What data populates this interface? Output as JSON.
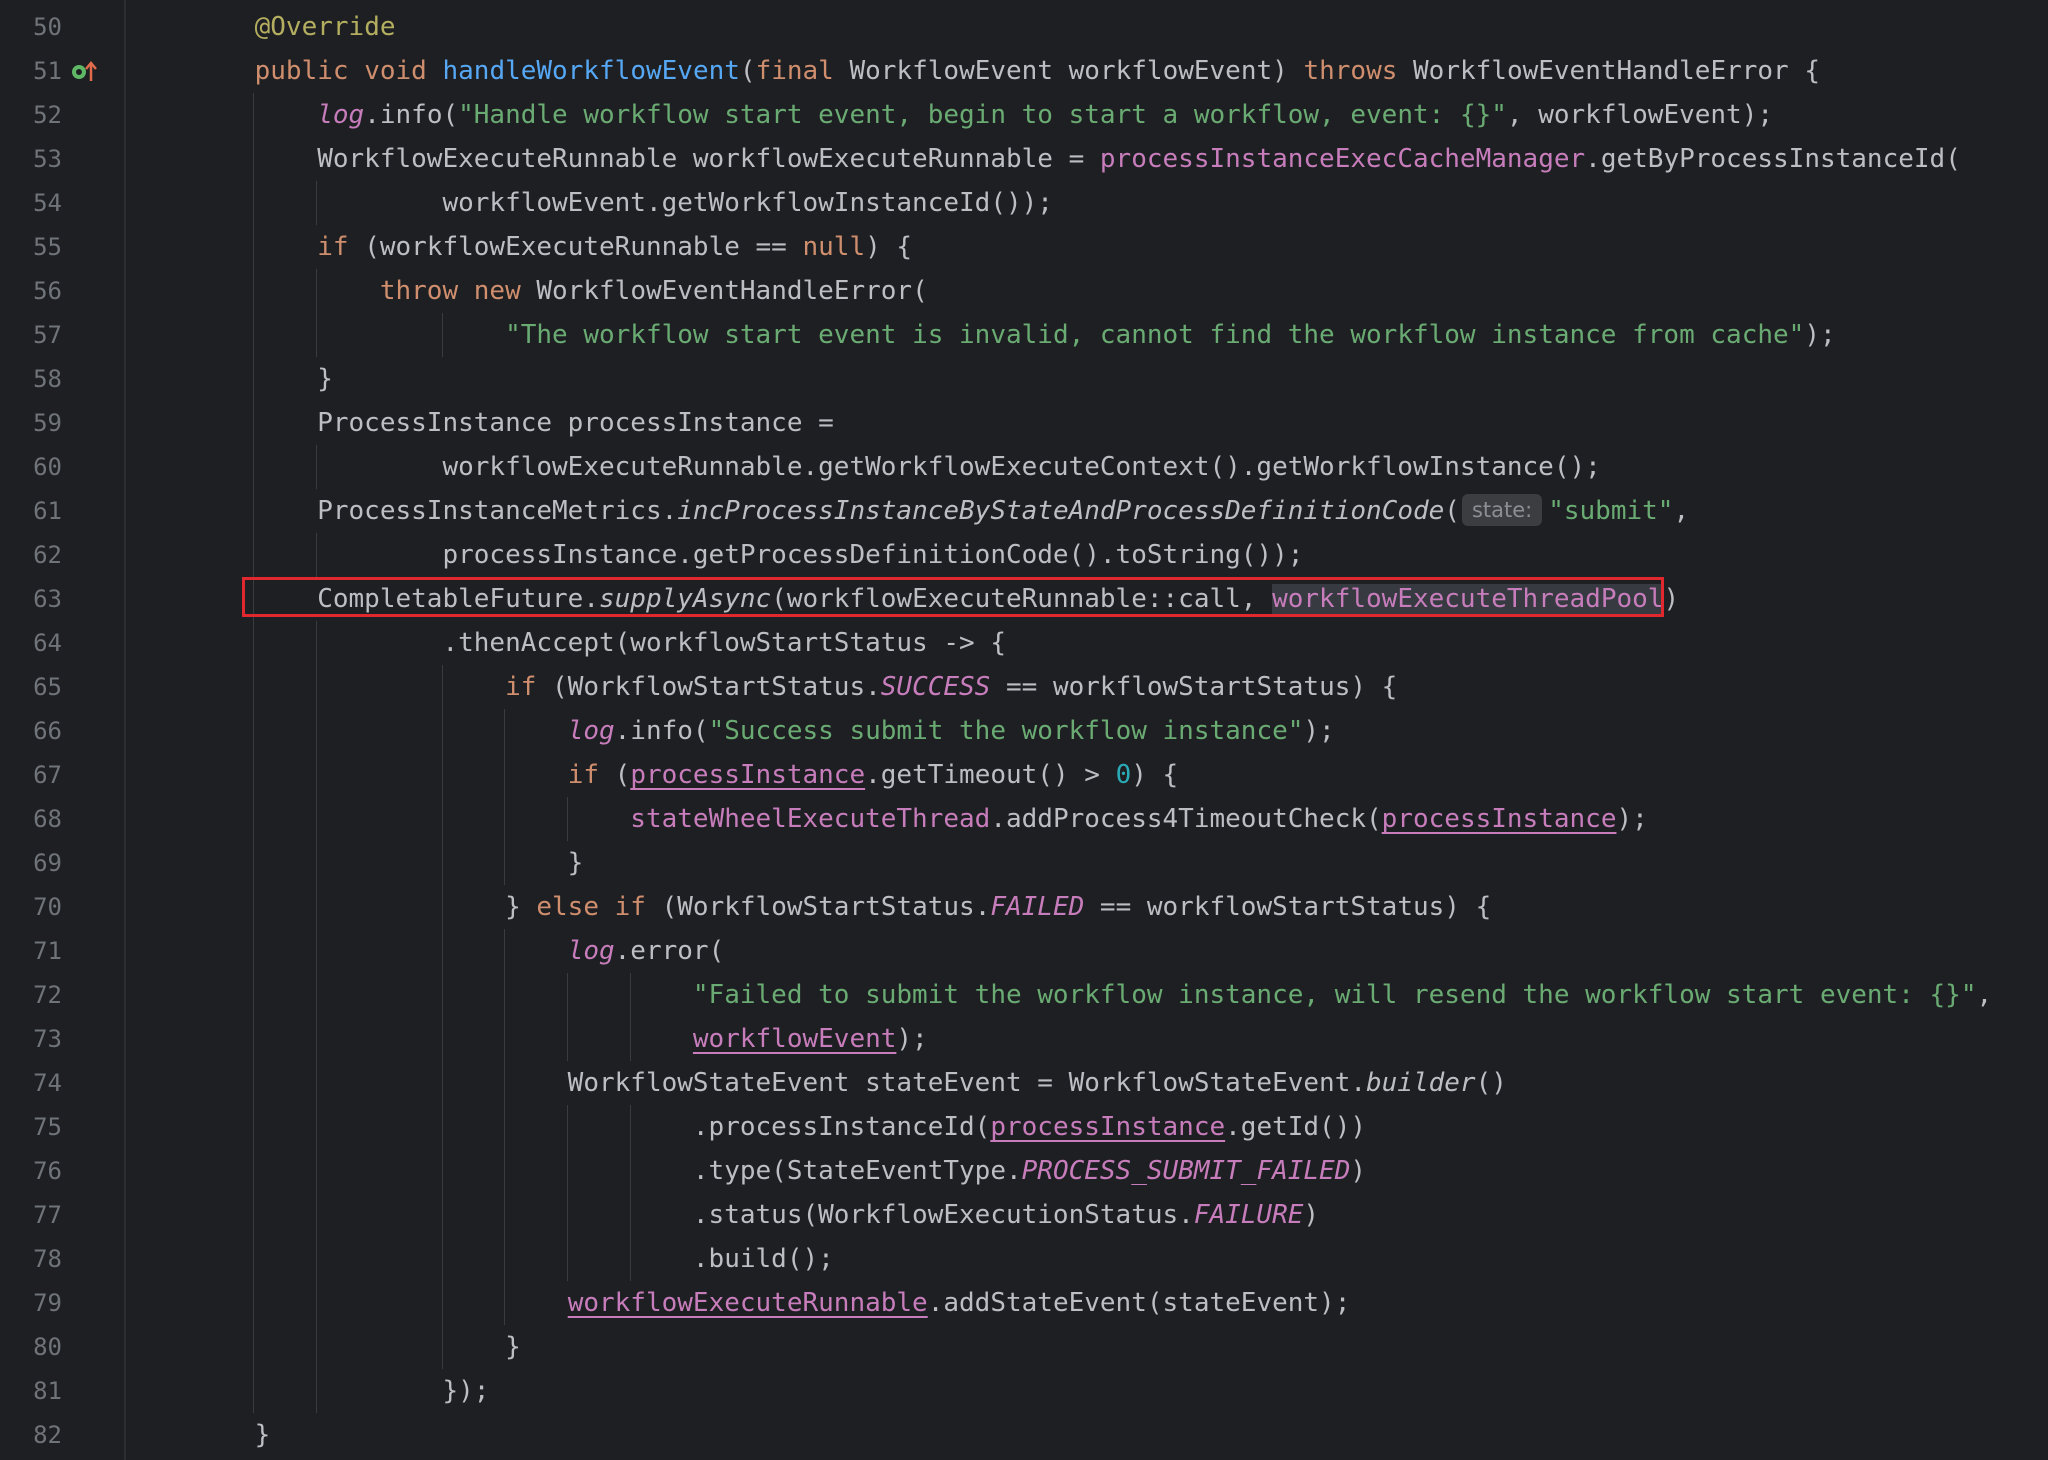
{
  "editor": {
    "line_numbers": [
      "50",
      "51",
      "52",
      "53",
      "54",
      "55",
      "56",
      "57",
      "58",
      "59",
      "60",
      "61",
      "62",
      "63",
      "64",
      "65",
      "66",
      "67",
      "68",
      "69",
      "70",
      "71",
      "72",
      "73",
      "74",
      "75",
      "76",
      "77",
      "78",
      "79",
      "80",
      "81",
      "82"
    ],
    "gutter_icon": "override-implementation-icon",
    "colors": {
      "background": "#1e1f22",
      "keyword": "#cf8e6d",
      "string": "#6aab73",
      "function": "#56a8f5",
      "field": "#c77dbb",
      "annotation": "#b3ae60",
      "number": "#2aacb8",
      "highlight_border": "#e0282e"
    },
    "lines": [
      [
        {
          "t": "    "
        },
        {
          "t": "@Override",
          "c": "ann"
        }
      ],
      [
        {
          "t": "    "
        },
        {
          "t": "public",
          "c": "kw"
        },
        {
          "t": " "
        },
        {
          "t": "void",
          "c": "kw"
        },
        {
          "t": " "
        },
        {
          "t": "handleWorkflowEvent",
          "c": "fn"
        },
        {
          "t": "("
        },
        {
          "t": "final",
          "c": "kw"
        },
        {
          "t": " WorkflowEvent workflowEvent) "
        },
        {
          "t": "throws",
          "c": "kw"
        },
        {
          "t": " WorkflowEventHandleError {"
        }
      ],
      [
        {
          "t": "        "
        },
        {
          "t": "log",
          "c": "static"
        },
        {
          "t": ".info("
        },
        {
          "t": "\"Handle workflow start event, begin to start a workflow, event: {}\"",
          "c": "str"
        },
        {
          "t": ", workflowEvent);"
        }
      ],
      [
        {
          "t": "        WorkflowExecuteRunnable workflowExecuteRunnable = "
        },
        {
          "t": "processInstanceExecCacheManager",
          "c": "field"
        },
        {
          "t": ".getByProcessInstanceId("
        }
      ],
      [
        {
          "t": "                workflowEvent.getWorkflowInstanceId());"
        }
      ],
      [
        {
          "t": "        "
        },
        {
          "t": "if",
          "c": "kw"
        },
        {
          "t": " (workflowExecuteRunnable == "
        },
        {
          "t": "null",
          "c": "kw"
        },
        {
          "t": ") {"
        }
      ],
      [
        {
          "t": "            "
        },
        {
          "t": "throw",
          "c": "kw"
        },
        {
          "t": " "
        },
        {
          "t": "new",
          "c": "kw"
        },
        {
          "t": " WorkflowEventHandleError("
        }
      ],
      [
        {
          "t": "                    "
        },
        {
          "t": "\"The workflow start event is invalid, cannot find the workflow instance from cache\"",
          "c": "str"
        },
        {
          "t": ");"
        }
      ],
      [
        {
          "t": "        }"
        }
      ],
      [
        {
          "t": "        ProcessInstance processInstance ="
        }
      ],
      [
        {
          "t": "                workflowExecuteRunnable.getWorkflowExecuteContext().getWorkflowInstance();"
        }
      ],
      [
        {
          "t": "        ProcessInstanceMetrics."
        },
        {
          "t": "incProcessInstanceByStateAndProcessDefinitionCode",
          "c": "italic"
        },
        {
          "t": "("
        },
        {
          "t": "state:",
          "c": "hint"
        },
        {
          "t": "\"submit\"",
          "c": "str"
        },
        {
          "t": ","
        }
      ],
      [
        {
          "t": "                processInstance.getProcessDefinitionCode().toString());"
        }
      ],
      [
        {
          "t": "        CompletableFuture."
        },
        {
          "t": "supplyAsync",
          "c": "italic"
        },
        {
          "t": "(workflowExecuteRunnable::call, "
        },
        {
          "t": "workflowExecuteThreadPool",
          "c": "hl"
        },
        {
          "t": ")"
        }
      ],
      [
        {
          "t": "                .thenAccept(workflowStartStatus -> {"
        }
      ],
      [
        {
          "t": "                    "
        },
        {
          "t": "if",
          "c": "kw"
        },
        {
          "t": " (WorkflowStartStatus."
        },
        {
          "t": "SUCCESS",
          "c": "static"
        },
        {
          "t": " == workflowStartStatus) {"
        }
      ],
      [
        {
          "t": "                        "
        },
        {
          "t": "log",
          "c": "static"
        },
        {
          "t": ".info("
        },
        {
          "t": "\"Success submit the workflow instance\"",
          "c": "str"
        },
        {
          "t": ");"
        }
      ],
      [
        {
          "t": "                        "
        },
        {
          "t": "if",
          "c": "kw"
        },
        {
          "t": " ("
        },
        {
          "t": "processInstance",
          "c": "ul"
        },
        {
          "t": ".getTimeout() > "
        },
        {
          "t": "0",
          "c": "num"
        },
        {
          "t": ") {"
        }
      ],
      [
        {
          "t": "                            "
        },
        {
          "t": "stateWheelExecuteThread",
          "c": "field"
        },
        {
          "t": ".addProcess4TimeoutCheck("
        },
        {
          "t": "processInstance",
          "c": "ul"
        },
        {
          "t": ");"
        }
      ],
      [
        {
          "t": "                        }"
        }
      ],
      [
        {
          "t": "                    } "
        },
        {
          "t": "else",
          "c": "kw"
        },
        {
          "t": " "
        },
        {
          "t": "if",
          "c": "kw"
        },
        {
          "t": " (WorkflowStartStatus."
        },
        {
          "t": "FAILED",
          "c": "static"
        },
        {
          "t": " == workflowStartStatus) {"
        }
      ],
      [
        {
          "t": "                        "
        },
        {
          "t": "log",
          "c": "static"
        },
        {
          "t": ".error("
        }
      ],
      [
        {
          "t": "                                "
        },
        {
          "t": "\"Failed to submit the workflow instance, will resend the workflow start event: {}\"",
          "c": "str"
        },
        {
          "t": ","
        }
      ],
      [
        {
          "t": "                                "
        },
        {
          "t": "workflowEvent",
          "c": "ul"
        },
        {
          "t": ");"
        }
      ],
      [
        {
          "t": "                        WorkflowStateEvent stateEvent = WorkflowStateEvent."
        },
        {
          "t": "builder",
          "c": "italic"
        },
        {
          "t": "()"
        }
      ],
      [
        {
          "t": "                                .processInstanceId("
        },
        {
          "t": "processInstance",
          "c": "ul"
        },
        {
          "t": ".getId())"
        }
      ],
      [
        {
          "t": "                                .type(StateEventType."
        },
        {
          "t": "PROCESS_SUBMIT_FAILED",
          "c": "static"
        },
        {
          "t": ")"
        }
      ],
      [
        {
          "t": "                                .status(WorkflowExecutionStatus."
        },
        {
          "t": "FAILURE",
          "c": "static"
        },
        {
          "t": ")"
        }
      ],
      [
        {
          "t": "                                .build();"
        }
      ],
      [
        {
          "t": "                        "
        },
        {
          "t": "workflowExecuteRunnable",
          "c": "ul"
        },
        {
          "t": ".addStateEvent(stateEvent);"
        }
      ],
      [
        {
          "t": "                    }"
        }
      ],
      [
        {
          "t": "                });"
        }
      ],
      [
        {
          "t": "    }"
        }
      ]
    ]
  }
}
